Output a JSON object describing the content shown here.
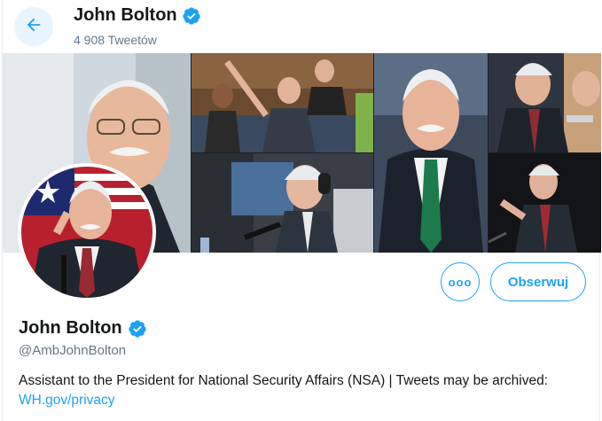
{
  "header": {
    "name": "John Bolton",
    "tweet_count": "4 908 Tweetów"
  },
  "actions": {
    "more_label": "ooo",
    "follow_label": "Obserwuj"
  },
  "profile": {
    "name": "John Bolton",
    "handle": "@AmbJohnBolton",
    "bio_text": "Assistant to the President for National Security Affairs (NSA) | Tweets may be archived: ",
    "bio_link": "WH.gov/privacy"
  },
  "icons": {
    "back": "arrow-left-icon",
    "verified": "verified-badge-icon",
    "more": "ellipsis-icon"
  },
  "colors": {
    "accent": "#1da1f2",
    "text_primary": "#14171a",
    "text_secondary": "#657786",
    "back_bg": "#e8f5fe"
  }
}
